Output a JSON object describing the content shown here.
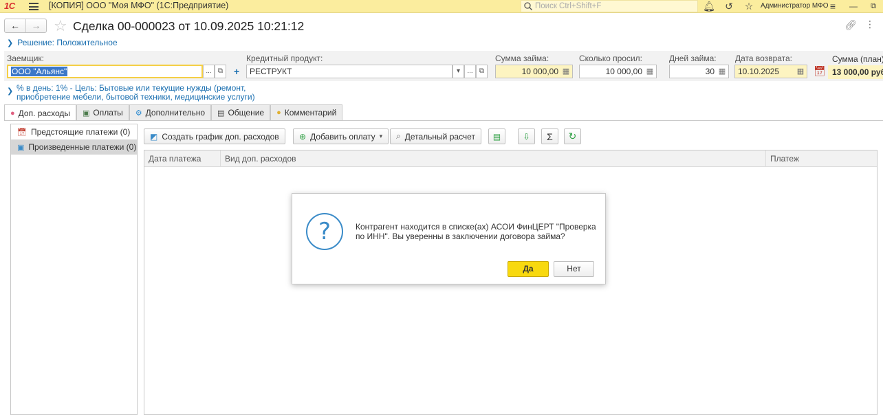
{
  "app": {
    "logo": "1С",
    "title": "[КОПИЯ] ООО \"Моя МФО\"  (1С:Предприятие)",
    "search_placeholder": "Поиск Ctrl+Shift+F",
    "user": "Администратор МФО"
  },
  "doc": {
    "title": "Сделка 00-000023 от 10.09.2025 10:21:12",
    "decision_link": "Решение: Положительное",
    "description": [
      "% в день: 1% - Цель: Бытовые или текущие нужды (ремонт,",
      "приобретение мебели, бытовой техники, медицинские услуги)"
    ]
  },
  "fields": {
    "borrower_label": "Заемщик:",
    "borrower_value": "ООО \"Альянс\"",
    "product_label": "Кредитный продукт:",
    "product_value": "РЕСТРУКТ",
    "loan_sum_label": "Сумма займа:",
    "loan_sum_value": "10 000,00",
    "requested_label": "Сколько просил:",
    "requested_value": "10 000,00",
    "days_label": "Дней займа:",
    "days_value": "30",
    "return_date_label": "Дата возврата:",
    "return_date_value": "10.10.2025",
    "plan_sum_label": "Сумма (план)",
    "plan_sum_value": "13 000,00 руб"
  },
  "tabs": [
    {
      "label": "Доп. расходы",
      "icon": "piggy-icon"
    },
    {
      "label": "Оплаты",
      "icon": "payment-icon"
    },
    {
      "label": "Дополнительно",
      "icon": "gear-icon"
    },
    {
      "label": "Общение",
      "icon": "chat-icon"
    },
    {
      "label": "Комментарий",
      "icon": "comment-icon"
    }
  ],
  "left_panel": {
    "items": [
      {
        "label": "Предстоящие платежи (0)"
      },
      {
        "label": "Произведенные платежи (0)"
      }
    ]
  },
  "toolbar": {
    "create_schedule": "Создать график доп. расходов",
    "add_payment": "Добавить оплату",
    "detailed_calc": "Детальный расчет"
  },
  "table": {
    "columns": [
      "Дата платежа",
      "Вид доп. расходов",
      "Платеж"
    ]
  },
  "dialog": {
    "message": "Контрагент находится в списке(ах) АСОИ ФинЦЕРТ \"Проверка по ИНН\". Вы уверенны в заключении договора займа?",
    "yes": "Да",
    "no": "Нет"
  }
}
